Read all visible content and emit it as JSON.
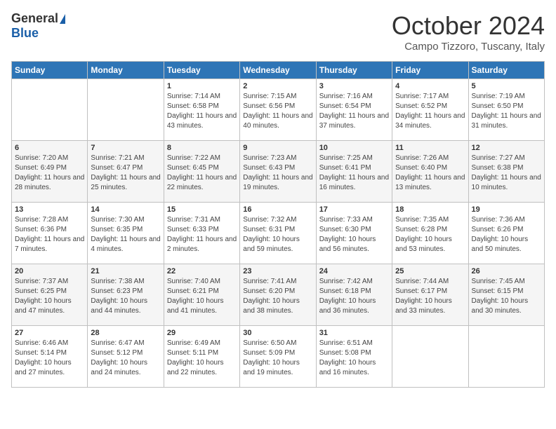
{
  "header": {
    "logo_general": "General",
    "logo_blue": "Blue",
    "month": "October 2024",
    "location": "Campo Tizzoro, Tuscany, Italy"
  },
  "days_of_week": [
    "Sunday",
    "Monday",
    "Tuesday",
    "Wednesday",
    "Thursday",
    "Friday",
    "Saturday"
  ],
  "weeks": [
    [
      null,
      null,
      {
        "day": "1",
        "sunrise": "Sunrise: 7:14 AM",
        "sunset": "Sunset: 6:58 PM",
        "daylight": "Daylight: 11 hours and 43 minutes."
      },
      {
        "day": "2",
        "sunrise": "Sunrise: 7:15 AM",
        "sunset": "Sunset: 6:56 PM",
        "daylight": "Daylight: 11 hours and 40 minutes."
      },
      {
        "day": "3",
        "sunrise": "Sunrise: 7:16 AM",
        "sunset": "Sunset: 6:54 PM",
        "daylight": "Daylight: 11 hours and 37 minutes."
      },
      {
        "day": "4",
        "sunrise": "Sunrise: 7:17 AM",
        "sunset": "Sunset: 6:52 PM",
        "daylight": "Daylight: 11 hours and 34 minutes."
      },
      {
        "day": "5",
        "sunrise": "Sunrise: 7:19 AM",
        "sunset": "Sunset: 6:50 PM",
        "daylight": "Daylight: 11 hours and 31 minutes."
      }
    ],
    [
      {
        "day": "6",
        "sunrise": "Sunrise: 7:20 AM",
        "sunset": "Sunset: 6:49 PM",
        "daylight": "Daylight: 11 hours and 28 minutes."
      },
      {
        "day": "7",
        "sunrise": "Sunrise: 7:21 AM",
        "sunset": "Sunset: 6:47 PM",
        "daylight": "Daylight: 11 hours and 25 minutes."
      },
      {
        "day": "8",
        "sunrise": "Sunrise: 7:22 AM",
        "sunset": "Sunset: 6:45 PM",
        "daylight": "Daylight: 11 hours and 22 minutes."
      },
      {
        "day": "9",
        "sunrise": "Sunrise: 7:23 AM",
        "sunset": "Sunset: 6:43 PM",
        "daylight": "Daylight: 11 hours and 19 minutes."
      },
      {
        "day": "10",
        "sunrise": "Sunrise: 7:25 AM",
        "sunset": "Sunset: 6:41 PM",
        "daylight": "Daylight: 11 hours and 16 minutes."
      },
      {
        "day": "11",
        "sunrise": "Sunrise: 7:26 AM",
        "sunset": "Sunset: 6:40 PM",
        "daylight": "Daylight: 11 hours and 13 minutes."
      },
      {
        "day": "12",
        "sunrise": "Sunrise: 7:27 AM",
        "sunset": "Sunset: 6:38 PM",
        "daylight": "Daylight: 11 hours and 10 minutes."
      }
    ],
    [
      {
        "day": "13",
        "sunrise": "Sunrise: 7:28 AM",
        "sunset": "Sunset: 6:36 PM",
        "daylight": "Daylight: 11 hours and 7 minutes."
      },
      {
        "day": "14",
        "sunrise": "Sunrise: 7:30 AM",
        "sunset": "Sunset: 6:35 PM",
        "daylight": "Daylight: 11 hours and 4 minutes."
      },
      {
        "day": "15",
        "sunrise": "Sunrise: 7:31 AM",
        "sunset": "Sunset: 6:33 PM",
        "daylight": "Daylight: 11 hours and 2 minutes."
      },
      {
        "day": "16",
        "sunrise": "Sunrise: 7:32 AM",
        "sunset": "Sunset: 6:31 PM",
        "daylight": "Daylight: 10 hours and 59 minutes."
      },
      {
        "day": "17",
        "sunrise": "Sunrise: 7:33 AM",
        "sunset": "Sunset: 6:30 PM",
        "daylight": "Daylight: 10 hours and 56 minutes."
      },
      {
        "day": "18",
        "sunrise": "Sunrise: 7:35 AM",
        "sunset": "Sunset: 6:28 PM",
        "daylight": "Daylight: 10 hours and 53 minutes."
      },
      {
        "day": "19",
        "sunrise": "Sunrise: 7:36 AM",
        "sunset": "Sunset: 6:26 PM",
        "daylight": "Daylight: 10 hours and 50 minutes."
      }
    ],
    [
      {
        "day": "20",
        "sunrise": "Sunrise: 7:37 AM",
        "sunset": "Sunset: 6:25 PM",
        "daylight": "Daylight: 10 hours and 47 minutes."
      },
      {
        "day": "21",
        "sunrise": "Sunrise: 7:38 AM",
        "sunset": "Sunset: 6:23 PM",
        "daylight": "Daylight: 10 hours and 44 minutes."
      },
      {
        "day": "22",
        "sunrise": "Sunrise: 7:40 AM",
        "sunset": "Sunset: 6:21 PM",
        "daylight": "Daylight: 10 hours and 41 minutes."
      },
      {
        "day": "23",
        "sunrise": "Sunrise: 7:41 AM",
        "sunset": "Sunset: 6:20 PM",
        "daylight": "Daylight: 10 hours and 38 minutes."
      },
      {
        "day": "24",
        "sunrise": "Sunrise: 7:42 AM",
        "sunset": "Sunset: 6:18 PM",
        "daylight": "Daylight: 10 hours and 36 minutes."
      },
      {
        "day": "25",
        "sunrise": "Sunrise: 7:44 AM",
        "sunset": "Sunset: 6:17 PM",
        "daylight": "Daylight: 10 hours and 33 minutes."
      },
      {
        "day": "26",
        "sunrise": "Sunrise: 7:45 AM",
        "sunset": "Sunset: 6:15 PM",
        "daylight": "Daylight: 10 hours and 30 minutes."
      }
    ],
    [
      {
        "day": "27",
        "sunrise": "Sunrise: 6:46 AM",
        "sunset": "Sunset: 5:14 PM",
        "daylight": "Daylight: 10 hours and 27 minutes."
      },
      {
        "day": "28",
        "sunrise": "Sunrise: 6:47 AM",
        "sunset": "Sunset: 5:12 PM",
        "daylight": "Daylight: 10 hours and 24 minutes."
      },
      {
        "day": "29",
        "sunrise": "Sunrise: 6:49 AM",
        "sunset": "Sunset: 5:11 PM",
        "daylight": "Daylight: 10 hours and 22 minutes."
      },
      {
        "day": "30",
        "sunrise": "Sunrise: 6:50 AM",
        "sunset": "Sunset: 5:09 PM",
        "daylight": "Daylight: 10 hours and 19 minutes."
      },
      {
        "day": "31",
        "sunrise": "Sunrise: 6:51 AM",
        "sunset": "Sunset: 5:08 PM",
        "daylight": "Daylight: 10 hours and 16 minutes."
      },
      null,
      null
    ]
  ]
}
